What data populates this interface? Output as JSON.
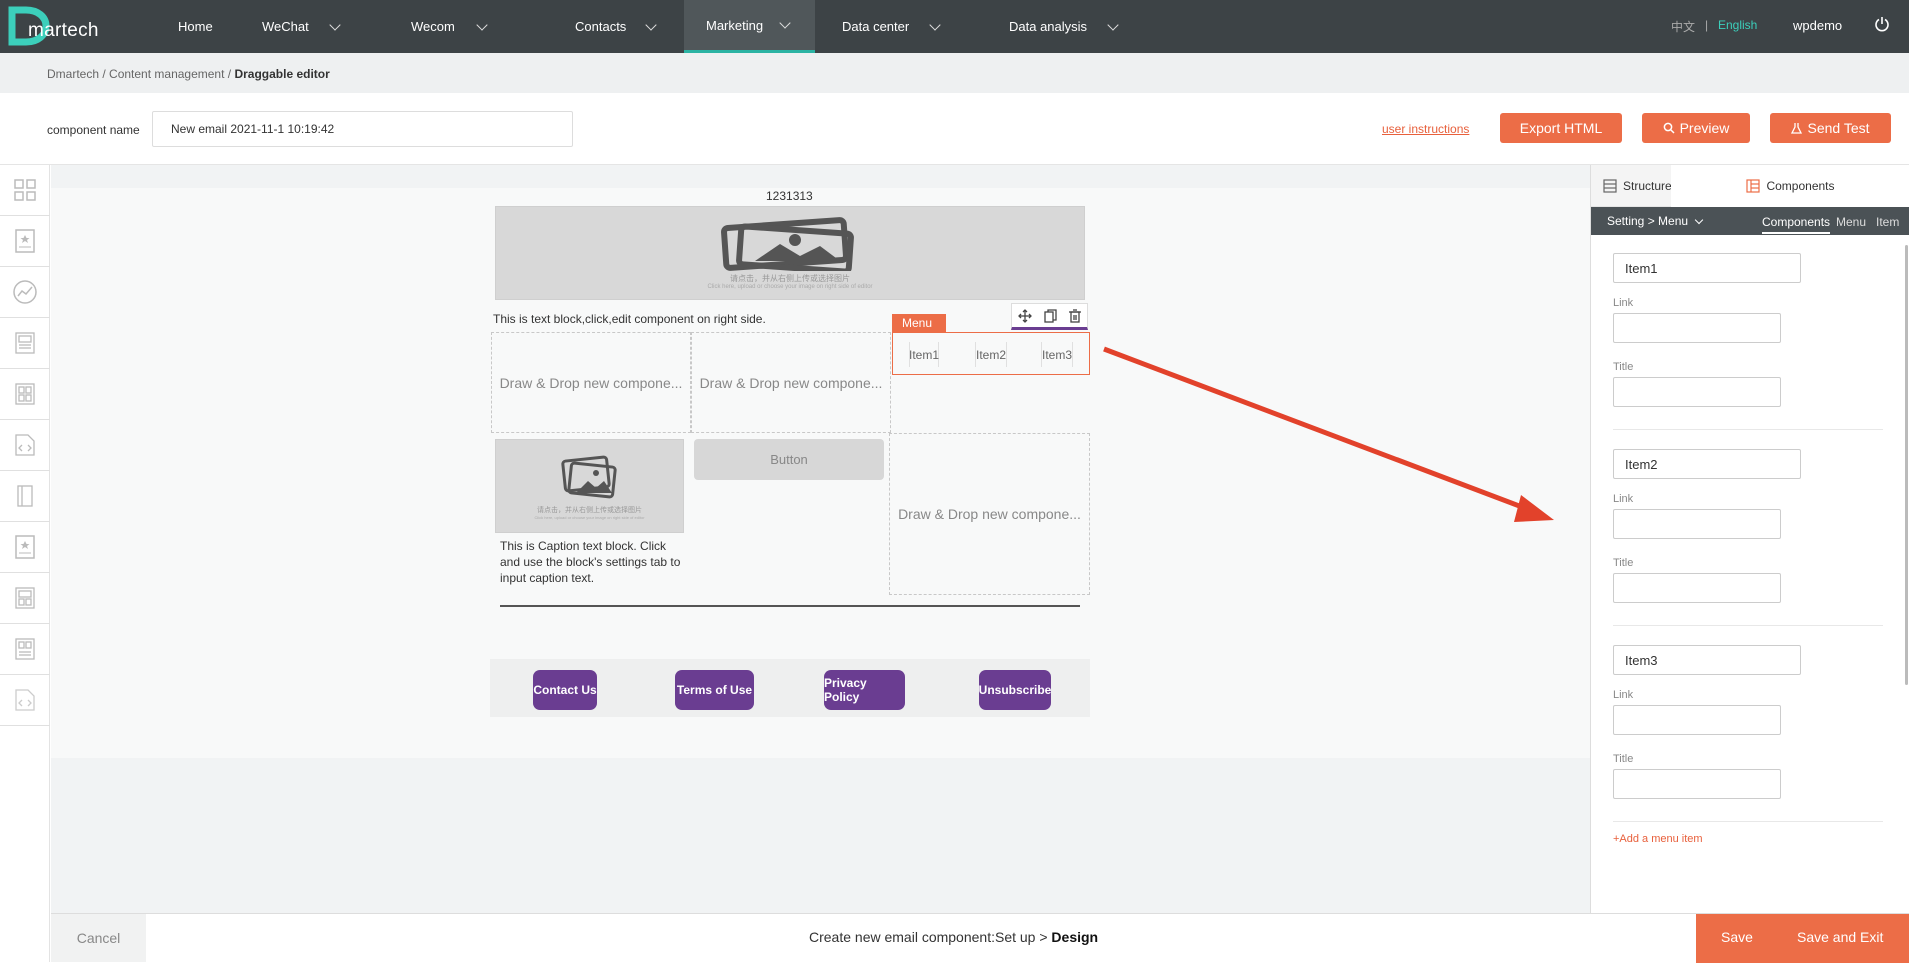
{
  "nav": {
    "logo": "martech",
    "items": [
      {
        "label": "Home",
        "chevron": false
      },
      {
        "label": "WeChat",
        "chevron": true
      },
      {
        "label": "Wecom",
        "chevron": true
      },
      {
        "label": "Contacts",
        "chevron": true
      },
      {
        "label": "Marketing",
        "chevron": true,
        "active": true
      },
      {
        "label": "Data center",
        "chevron": true
      },
      {
        "label": "Data analysis",
        "chevron": true
      }
    ],
    "lang_cn": "中文",
    "lang_sep": "|",
    "lang_en": "English",
    "user": "wpdemo",
    "power_icon": "power-icon"
  },
  "breadcrumb": {
    "part1": "Dmartech",
    "sep": " / ",
    "part2": "Content management",
    "current": "Draggable editor"
  },
  "toolbar": {
    "component_name_label": "component name",
    "component_name_value": "New email 2021-11-1 10:19:42",
    "user_instructions": "user instructions",
    "export_html": "Export HTML",
    "preview": "Preview",
    "send_test": "Send Test"
  },
  "rail": [
    "grid-icon",
    "card-icon",
    "chart-icon",
    "layout-icon",
    "layout-icon",
    "code-icon",
    "book-icon",
    "card-icon",
    "layout-icon",
    "layout-icon",
    "code-icon"
  ],
  "canvas": {
    "title": "1231313",
    "image_caption_cn": "请点击，并从右侧上传或选择图片",
    "image_caption_en": "Click here, upload or choose your image on right side of editor",
    "text_block": "This is text block,click,edit component on right side.",
    "drop_zone": "Draw & Drop new compone...",
    "menu_tag": "Menu",
    "menu_items": [
      "Item1",
      "Item2",
      "Item3"
    ],
    "button_label": "Button",
    "caption_text": "This is Caption text block. Click and use the block's settings tab to input caption text.",
    "footer_buttons": [
      "Contact Us",
      "Terms of Use",
      "Privacy Policy",
      "Unsubscribe"
    ]
  },
  "right_panel": {
    "tab_structure": "Structure",
    "tab_components": "Components",
    "setting_crumb": "Setting > Menu",
    "subtabs": [
      "Components",
      "Menu",
      "Item"
    ],
    "link_label": "Link",
    "title_label": "Title",
    "items": [
      {
        "name": "Item1",
        "link": "",
        "title": ""
      },
      {
        "name": "Item2",
        "link": "",
        "title": ""
      },
      {
        "name": "Item3",
        "link": "",
        "title": ""
      }
    ],
    "add_item": "+Add a menu item"
  },
  "bottom": {
    "cancel": "Cancel",
    "steps_prefix": "Create new email component:Set up > ",
    "steps_current": "Design",
    "save": "Save",
    "save_exit": "Save and Exit"
  },
  "colors": {
    "accent": "#ec6d47",
    "nav_bg": "#3d4346",
    "brand_teal": "#2bb3a3",
    "footer_button": "#6a3d91",
    "annotation_arrow": "#e2422b"
  }
}
